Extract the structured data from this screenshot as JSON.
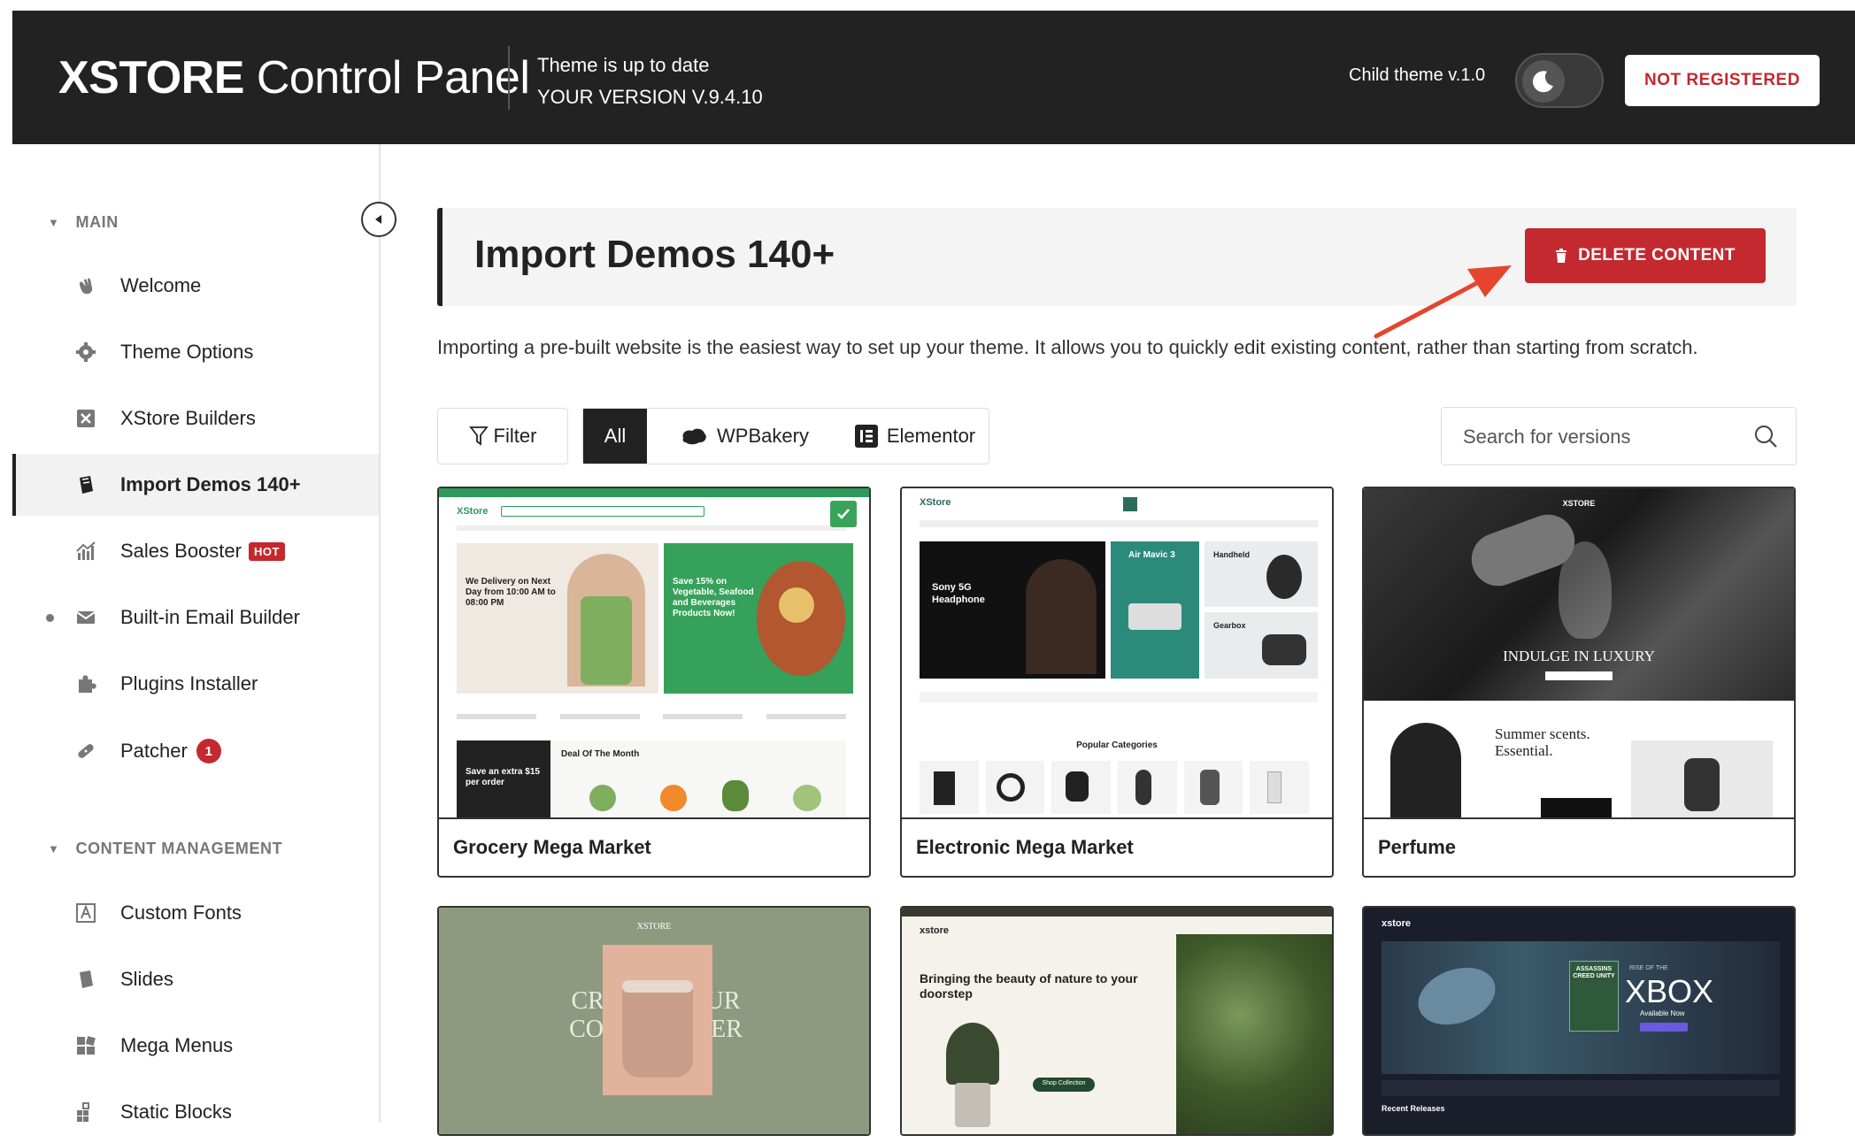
{
  "header": {
    "logo_bold": "XSTORE",
    "logo_light": "Control Panel",
    "status_line1": "Theme is up to date",
    "status_line2": "YOUR VERSION V.9.4.10",
    "child_theme": "Child theme v.1.0",
    "not_registered": "NOT REGISTERED"
  },
  "sidebar": {
    "sections": [
      {
        "title": "MAIN"
      },
      {
        "title": "CONTENT MANAGEMENT"
      }
    ],
    "main_items": [
      {
        "label": "Welcome",
        "icon": "hand-wave-icon"
      },
      {
        "label": "Theme Options",
        "icon": "gear-icon"
      },
      {
        "label": "XStore Builders",
        "icon": "x-box-icon"
      },
      {
        "label": "Import Demos 140+",
        "icon": "import-icon"
      },
      {
        "label": "Sales Booster",
        "icon": "chart-icon",
        "badge": "HOT"
      },
      {
        "label": "Built-in Email Builder",
        "icon": "envelope-icon"
      },
      {
        "label": "Plugins Installer",
        "icon": "puzzle-icon"
      },
      {
        "label": "Patcher",
        "icon": "bandage-icon",
        "count": "1"
      }
    ],
    "content_items": [
      {
        "label": "Custom Fonts",
        "icon": "font-icon"
      },
      {
        "label": "Slides",
        "icon": "slides-icon"
      },
      {
        "label": "Mega Menus",
        "icon": "grid-icon"
      },
      {
        "label": "Static Blocks",
        "icon": "blocks-icon"
      }
    ]
  },
  "main": {
    "title": "Import Demos 140+",
    "delete_label": "DELETE CONTENT",
    "intro": "Importing a pre-built website is the easiest way to set up your theme. It allows you to quickly edit existing content, rather than starting from scratch.",
    "filter_label": "Filter",
    "tabs": [
      "All",
      "WPBakery",
      "Elementor"
    ],
    "search_placeholder": "Search for versions",
    "demos": [
      {
        "name": "Grocery Mega Market"
      },
      {
        "name": "Electronic Mega Market"
      },
      {
        "name": "Perfume"
      }
    ]
  },
  "thumbs": {
    "grocery": {
      "logo": "XStore",
      "hero1": "We Delivery on Next Day from 10:00 AM to 08:00 PM",
      "hero2": "Save 15% on Vegetable, Seafood and Beverages Products Now!",
      "promo": "Save an extra $15 per order",
      "deal": "Deal Of The Month"
    },
    "electronic": {
      "logo": "XStore",
      "hero": "Sony 5G Headphone",
      "air": "Air Mavic 3",
      "handheld": "Handheld",
      "gearbox": "Gearbox",
      "popular": "Popular Categories"
    },
    "perfume": {
      "logo": "XSTORE",
      "hero": "INDULGE IN LUXURY",
      "summer": "Summer scents. Essential."
    },
    "candle": {
      "logo": "XSTORE",
      "big": "CREATE YOUR COZY CORNER"
    },
    "plants": {
      "logo": "xstore",
      "headline": "Bringing the beauty of nature to your doorstep",
      "btn": "Shop Collection"
    },
    "gaming": {
      "logo": "xstore",
      "rise": "RISE OF THE",
      "xbox": "XBOX",
      "avail": "Available Now",
      "recent": "Recent Releases",
      "game": "ASSASSINS CREED UNITY"
    }
  },
  "colors": {
    "header_bg": "#222222",
    "accent_red": "#c3292e",
    "grocery_green": "#2e9a5a",
    "candle_bg": "#8e9a80"
  }
}
